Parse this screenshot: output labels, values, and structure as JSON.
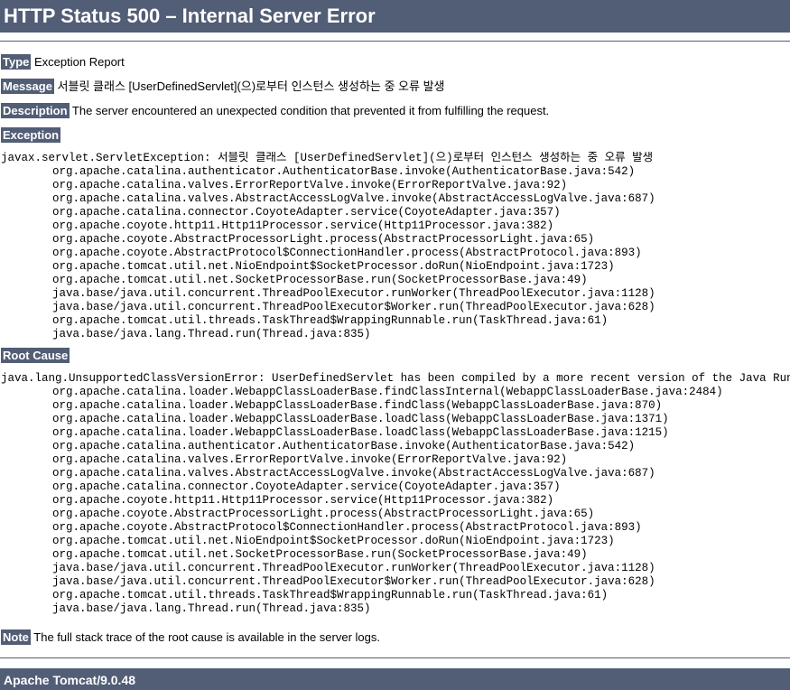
{
  "header": {
    "title": "HTTP Status 500 – Internal Server Error"
  },
  "fields": {
    "type_label": "Type",
    "type_value": "Exception Report",
    "message_label": "Message",
    "message_value": "서블릿 클래스 [UserDefinedServlet](으)로부터 인스턴스 생성하는 중 오류 발생",
    "description_label": "Description",
    "description_value": "The server encountered an unexpected condition that prevented it from fulfilling the request."
  },
  "exception": {
    "heading": "Exception",
    "head_line": "javax.servlet.ServletException: 서블릿 클래스 [UserDefinedServlet](으)로부터 인스턴스 생성하는 중 오류 발생",
    "frames": [
      "org.apache.catalina.authenticator.AuthenticatorBase.invoke(AuthenticatorBase.java:542)",
      "org.apache.catalina.valves.ErrorReportValve.invoke(ErrorReportValve.java:92)",
      "org.apache.catalina.valves.AbstractAccessLogValve.invoke(AbstractAccessLogValve.java:687)",
      "org.apache.catalina.connector.CoyoteAdapter.service(CoyoteAdapter.java:357)",
      "org.apache.coyote.http11.Http11Processor.service(Http11Processor.java:382)",
      "org.apache.coyote.AbstractProcessorLight.process(AbstractProcessorLight.java:65)",
      "org.apache.coyote.AbstractProtocol$ConnectionHandler.process(AbstractProtocol.java:893)",
      "org.apache.tomcat.util.net.NioEndpoint$SocketProcessor.doRun(NioEndpoint.java:1723)",
      "org.apache.tomcat.util.net.SocketProcessorBase.run(SocketProcessorBase.java:49)",
      "java.base/java.util.concurrent.ThreadPoolExecutor.runWorker(ThreadPoolExecutor.java:1128)",
      "java.base/java.util.concurrent.ThreadPoolExecutor$Worker.run(ThreadPoolExecutor.java:628)",
      "org.apache.tomcat.util.threads.TaskThread$WrappingRunnable.run(TaskThread.java:61)",
      "java.base/java.lang.Thread.run(Thread.java:835)"
    ]
  },
  "root_cause": {
    "heading": "Root Cause",
    "head_line": "java.lang.UnsupportedClassVersionError: UserDefinedServlet has been compiled by a more recent version of the Java Runtime",
    "frames": [
      "org.apache.catalina.loader.WebappClassLoaderBase.findClassInternal(WebappClassLoaderBase.java:2484)",
      "org.apache.catalina.loader.WebappClassLoaderBase.findClass(WebappClassLoaderBase.java:870)",
      "org.apache.catalina.loader.WebappClassLoaderBase.loadClass(WebappClassLoaderBase.java:1371)",
      "org.apache.catalina.loader.WebappClassLoaderBase.loadClass(WebappClassLoaderBase.java:1215)",
      "org.apache.catalina.authenticator.AuthenticatorBase.invoke(AuthenticatorBase.java:542)",
      "org.apache.catalina.valves.ErrorReportValve.invoke(ErrorReportValve.java:92)",
      "org.apache.catalina.valves.AbstractAccessLogValve.invoke(AbstractAccessLogValve.java:687)",
      "org.apache.catalina.connector.CoyoteAdapter.service(CoyoteAdapter.java:357)",
      "org.apache.coyote.http11.Http11Processor.service(Http11Processor.java:382)",
      "org.apache.coyote.AbstractProcessorLight.process(AbstractProcessorLight.java:65)",
      "org.apache.coyote.AbstractProtocol$ConnectionHandler.process(AbstractProtocol.java:893)",
      "org.apache.tomcat.util.net.NioEndpoint$SocketProcessor.doRun(NioEndpoint.java:1723)",
      "org.apache.tomcat.util.net.SocketProcessorBase.run(SocketProcessorBase.java:49)",
      "java.base/java.util.concurrent.ThreadPoolExecutor.runWorker(ThreadPoolExecutor.java:1128)",
      "java.base/java.util.concurrent.ThreadPoolExecutor$Worker.run(ThreadPoolExecutor.java:628)",
      "org.apache.tomcat.util.threads.TaskThread$WrappingRunnable.run(TaskThread.java:61)",
      "java.base/java.lang.Thread.run(Thread.java:835)"
    ]
  },
  "note": {
    "label": "Note",
    "value": "The full stack trace of the root cause is available in the server logs."
  },
  "footer": {
    "server": "Apache Tomcat/9.0.48"
  },
  "colors": {
    "banner_background": "#525D76",
    "banner_text": "#FFFFFF",
    "page_background": "#FFFFFF",
    "body_text": "#000000"
  }
}
